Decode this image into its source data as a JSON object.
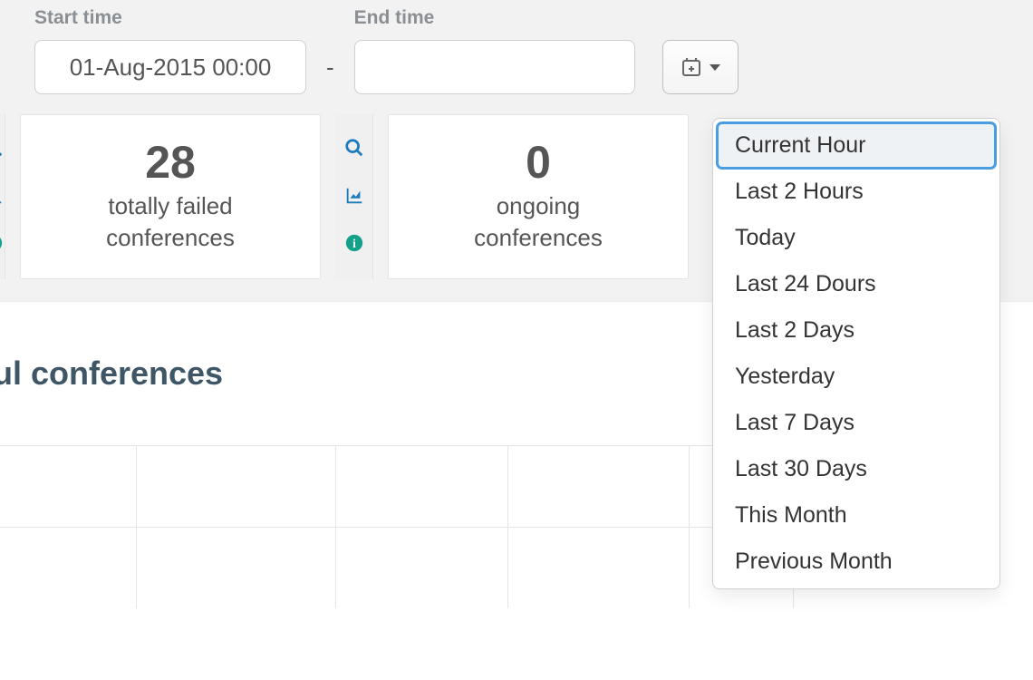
{
  "filters": {
    "start_label": "Start time",
    "start_value": "01-Aug-2015 00:00",
    "dash": "-",
    "end_label": "End time",
    "end_value": ""
  },
  "cards": {
    "c0": {
      "value": "28",
      "label_l1": "totally failed",
      "label_l2": "conferences"
    },
    "c1": {
      "value": "0",
      "label_l1": "ongoing",
      "label_l2": "conferences"
    }
  },
  "chart": {
    "title_fragment": "ful conferences"
  },
  "presets": {
    "items": [
      "Current Hour",
      "Last 2 Hours",
      "Today",
      "Last 24 Dours",
      "Last 2 Days",
      "Yesterday",
      "Last 7 Days",
      "Last 30 Days",
      "This Month",
      "Previous Month"
    ],
    "active_index": 0
  }
}
